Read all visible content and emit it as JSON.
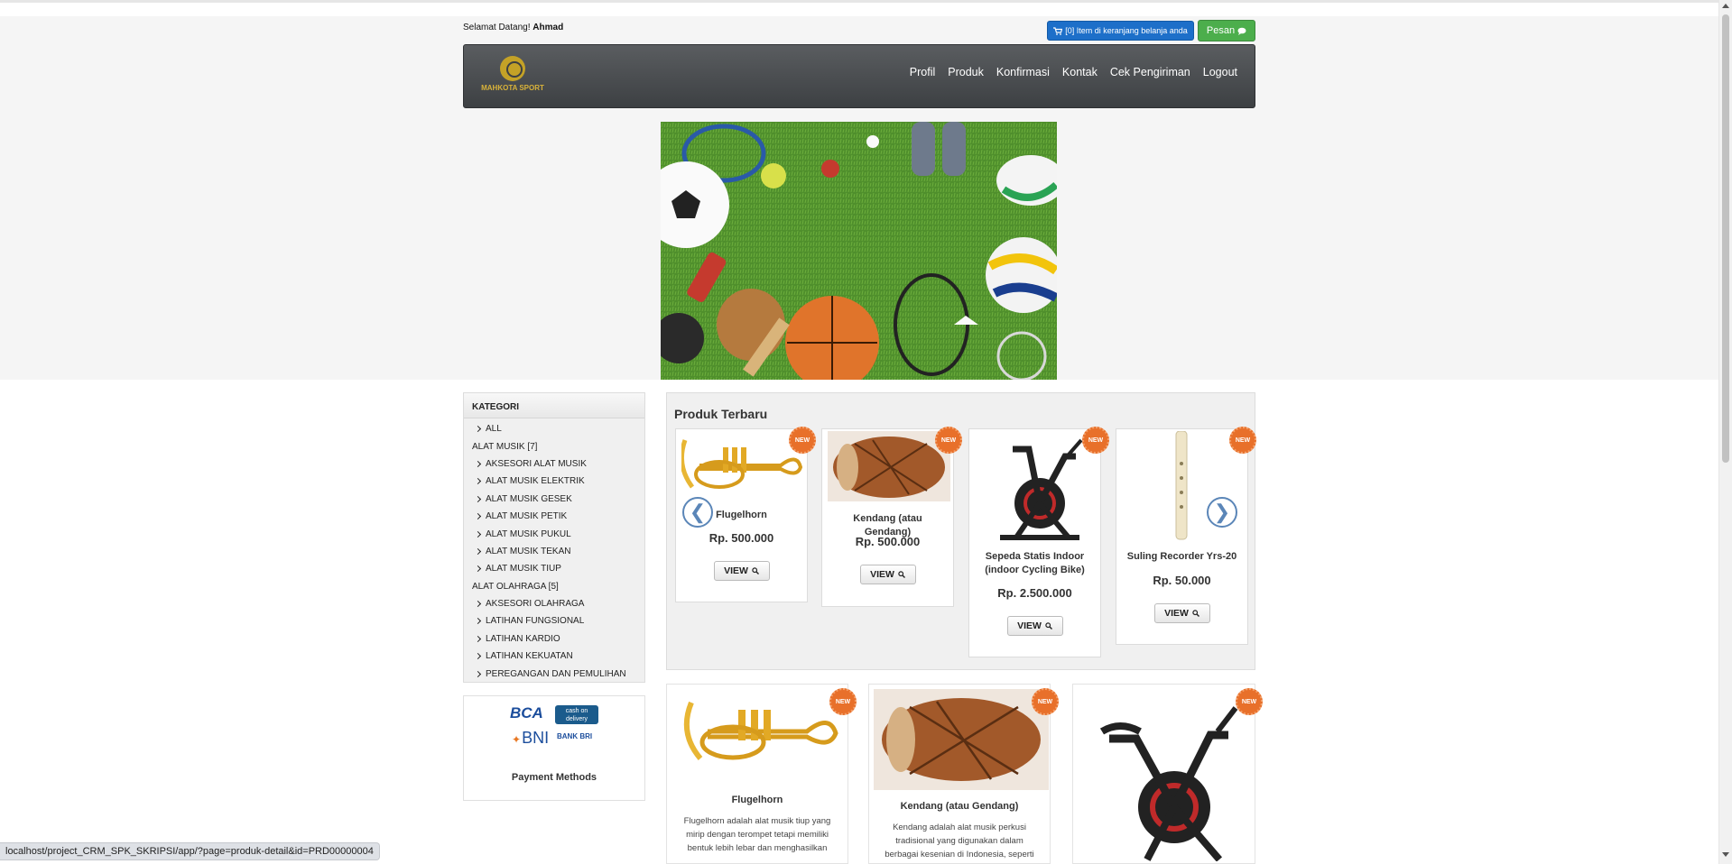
{
  "header": {
    "welcome_prefix": "Selamat Datang!",
    "user_name": "Ahmad",
    "cart_label": "[0] Item di keranjang belanja anda",
    "message_label": "Pesan"
  },
  "nav": {
    "logo_text": "MAHKOTA SPORT",
    "items": [
      "Profil",
      "Produk",
      "Konfirmasi",
      "Kontak",
      "Cek Pengiriman",
      "Logout"
    ]
  },
  "sidebar": {
    "title": "KATEGORI",
    "rows": [
      {
        "label": "ALL",
        "type": "item"
      },
      {
        "label": "ALAT MUSIK [7]",
        "type": "group"
      },
      {
        "label": "AKSESORI ALAT MUSIK",
        "type": "item"
      },
      {
        "label": "ALAT MUSIK ELEKTRIK",
        "type": "item"
      },
      {
        "label": "ALAT MUSIK GESEK",
        "type": "item"
      },
      {
        "label": "ALAT MUSIK PETIK",
        "type": "item"
      },
      {
        "label": "ALAT MUSIK PUKUL",
        "type": "item"
      },
      {
        "label": "ALAT MUSIK TEKAN",
        "type": "item"
      },
      {
        "label": "ALAT MUSIK TIUP",
        "type": "item"
      },
      {
        "label": "ALAT OLAHRAGA [5]",
        "type": "group"
      },
      {
        "label": "AKSESORI OLAHRAGA",
        "type": "item"
      },
      {
        "label": "LATIHAN FUNGSIONAL",
        "type": "item"
      },
      {
        "label": "LATIHAN KARDIO",
        "type": "item"
      },
      {
        "label": "LATIHAN KEKUATAN",
        "type": "item"
      },
      {
        "label": "PEREGANGAN DAN PEMULIHAN",
        "type": "item"
      }
    ]
  },
  "payment": {
    "title": "Payment Methods",
    "bca": "BCA",
    "cod": "cash on delivery",
    "bni": "BNI",
    "bri": "BANK BRI"
  },
  "newest": {
    "title": "Produk Terbaru",
    "badge": "NEW",
    "view_label": "VIEW",
    "products": [
      {
        "name": "Flugelhorn",
        "price": "Rp. 500.000"
      },
      {
        "name": "Kendang (atau Gendang)",
        "price": "Rp. 500.000"
      },
      {
        "name": "Sepeda Statis Indoor (indoor Cycling Bike)",
        "price": "Rp. 2.500.000"
      },
      {
        "name": "Suling Recorder Yrs-20",
        "price": "Rp. 50.000"
      }
    ]
  },
  "grid": {
    "products": [
      {
        "name": "Flugelhorn",
        "desc": "Flugelhorn adalah alat musik tiup yang mirip dengan terompet tetapi memiliki bentuk lebih lebar dan menghasilkan suara yang lebih hangat dan lembut."
      },
      {
        "name": "Kendang (atau Gendang)",
        "desc": "Kendang adalah alat musik perkusi tradisional yang digunakan dalam berbagai kesenian di Indonesia, seperti"
      }
    ]
  },
  "status_url": "localhost/project_CRM_SPK_SKRIPSI/app/?page=produk-detail&id=PRD00000004"
}
